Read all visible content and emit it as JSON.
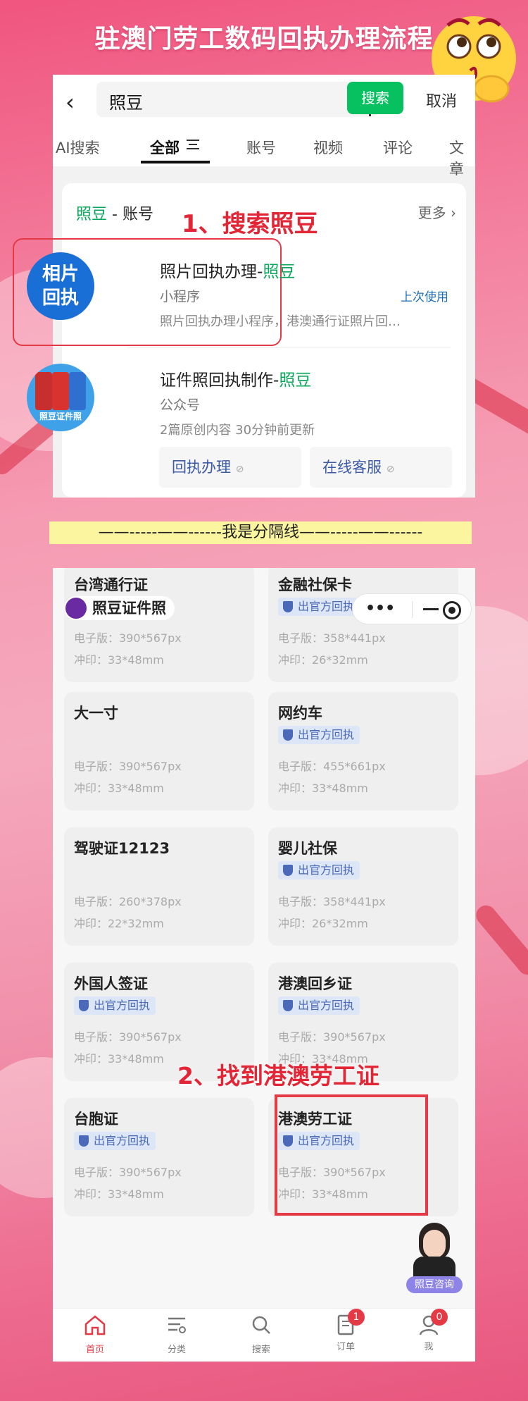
{
  "header": {
    "title": "驻澳门劳工数码回执办理流程"
  },
  "search": {
    "query": "照豆",
    "search_button": "搜索",
    "cancel": "取消",
    "tabs": [
      "AI搜索",
      "全部",
      "账号",
      "视频",
      "评论",
      "文章"
    ],
    "card_head_brand": "照豆",
    "card_head_rest": " - 账号",
    "more": "更多",
    "step_label": "1、搜索照豆",
    "results": [
      {
        "logo_text": "相片回执",
        "title_main": "照片回执办理-",
        "title_brand": "照豆",
        "type": "小程序",
        "desc": "照片回执办理小程序，港澳通行证照片回…",
        "last_used": "上次使用"
      },
      {
        "logo_text": "照豆证件照",
        "title_main": "证件照回执制作-",
        "title_brand": "照豆",
        "type": "公众号",
        "desc": "2篇原创内容  30分钟前更新",
        "buttons": [
          "回执办理",
          "在线客服"
        ]
      }
    ]
  },
  "separator": "——-----——------我是分隔线——-----——------",
  "app": {
    "brand": "照豆证件照",
    "step_label": "2、找到港澳劳工证",
    "docs": [
      {
        "title": "台湾通行证",
        "badge": "",
        "e": "电子版：390*567px",
        "c": "冲印：33*48mm"
      },
      {
        "title": "金融社保卡",
        "badge": "出官方回执",
        "e": "电子版：358*441px",
        "c": "冲印：26*32mm"
      },
      {
        "title": "大一寸",
        "badge": "",
        "e": "电子版：390*567px",
        "c": "冲印：33*48mm"
      },
      {
        "title": "网约车",
        "badge": "出官方回执",
        "e": "电子版：455*661px",
        "c": "冲印：33*48mm"
      },
      {
        "title": "驾驶证12123",
        "badge": "",
        "e": "电子版：260*378px",
        "c": "冲印：22*32mm"
      },
      {
        "title": "婴儿社保",
        "badge": "出官方回执",
        "e": "电子版：358*441px",
        "c": "冲印：26*32mm"
      },
      {
        "title": "外国人签证",
        "badge": "出官方回执",
        "e": "电子版：390*567px",
        "c": "冲印：33*48mm"
      },
      {
        "title": "港澳回乡证",
        "badge": "出官方回执",
        "e": "电子版：390*567px",
        "c": "冲印：33*48mm"
      },
      {
        "title": "台胞证",
        "badge": "出官方回执",
        "e": "电子版：390*567px",
        "c": "冲印：33*48mm"
      },
      {
        "title": "港澳劳工证",
        "badge": "出官方回执",
        "e": "电子版：390*567px",
        "c": "冲印：33*48mm"
      }
    ],
    "assistant_tag": "照豆咨询",
    "tabbar": [
      {
        "label": "首页",
        "icon": "home-icon",
        "badge": ""
      },
      {
        "label": "分类",
        "icon": "category-icon",
        "badge": ""
      },
      {
        "label": "搜索",
        "icon": "search-icon",
        "badge": ""
      },
      {
        "label": "订单",
        "icon": "order-icon",
        "badge": "1"
      },
      {
        "label": "我",
        "icon": "user-icon",
        "badge": "0"
      }
    ]
  },
  "colors": {
    "accent_green": "#07c160",
    "alert_red": "#e63946",
    "badge_blue": "#4a69b8"
  }
}
